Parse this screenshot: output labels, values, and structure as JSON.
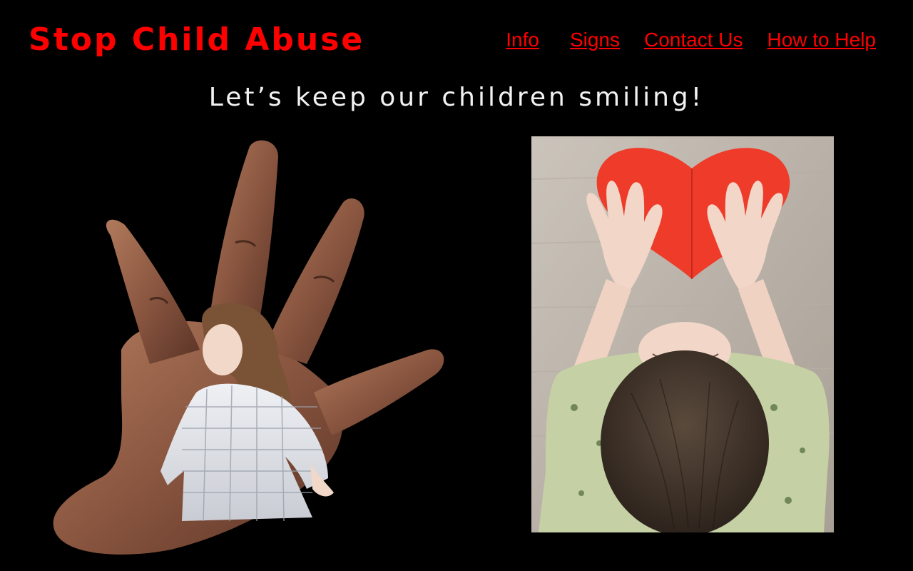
{
  "header": {
    "title": "Stop Child Abuse"
  },
  "nav": {
    "items": [
      {
        "label": "Info"
      },
      {
        "label": "Signs"
      },
      {
        "label": "Contact Us"
      },
      {
        "label": "How to Help"
      }
    ]
  },
  "tagline": "Let’s keep our children smiling!",
  "images": {
    "left": {
      "icon": "hand-and-child-illustration"
    },
    "right": {
      "icon": "child-with-paper-heart-photo"
    }
  },
  "colors": {
    "background": "#000000",
    "accent": "#ff0000",
    "tagline": "#f2f2f2"
  }
}
